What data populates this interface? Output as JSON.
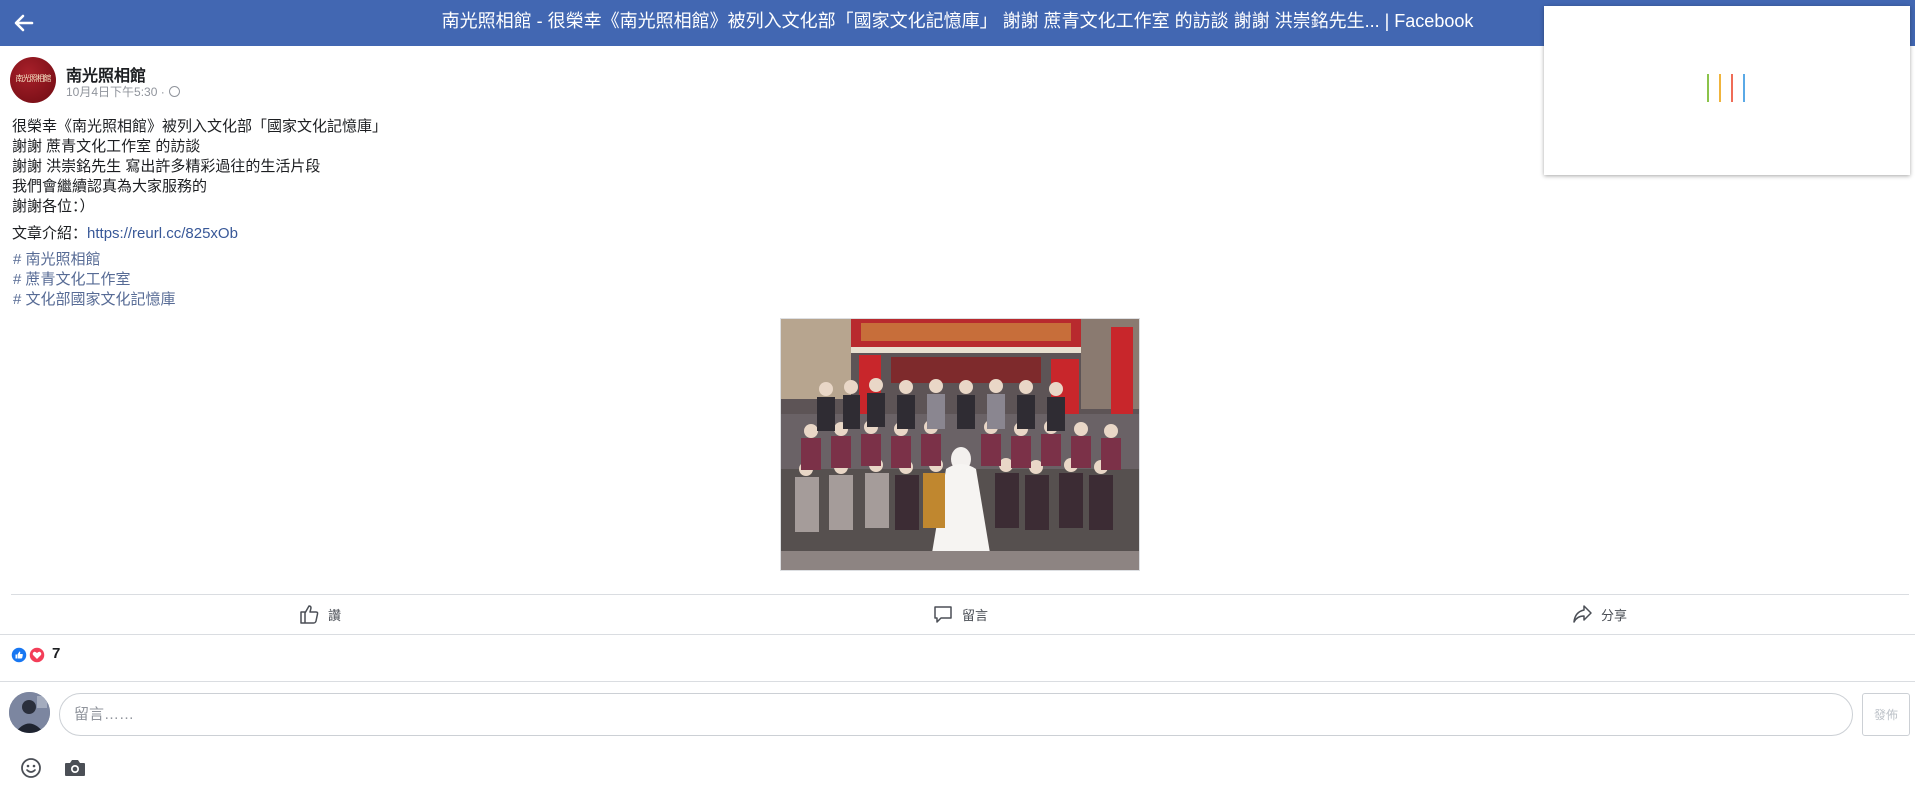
{
  "header": {
    "title": "南光照相館 - 很榮幸《南光照相館》被列入文化部「國家文化記憶庫」 謝謝 蔗青文化工作室 的訪談 謝謝 洪崇銘先生... | Facebook",
    "back_icon": "arrow-left-icon",
    "background_color": "#4267b2"
  },
  "loading_overlay": {
    "bar_colors": [
      "#8bc34a",
      "#f0b43c",
      "#ef6c57",
      "#5aa9e6"
    ]
  },
  "post": {
    "page_name": "南光照相館",
    "avatar_text": "南光照相館",
    "timestamp": "10月4日下午5:30 ·",
    "lines": [
      "很榮幸《南光照相館》被列入文化部「國家文化記憶庫」",
      "謝謝 蔗青文化工作室 的訪談",
      "謝謝 洪崇銘先生 寫出許多精彩過往的生活片段",
      "我們會繼續認真為大家服務的",
      "謝謝各位：）"
    ],
    "article_prefix": "文章介紹：",
    "article_link": "https://reurl.cc/825xOb",
    "hashtags": [
      "# 南光照相館",
      "# 蔗青文化工作室",
      "# 文化部國家文化記憶庫"
    ]
  },
  "actions": {
    "like": "讚",
    "comment": "留言",
    "share": "分享"
  },
  "reactions": {
    "count": "7",
    "icons": [
      "like-icon",
      "love-icon"
    ]
  },
  "composer": {
    "placeholder": "留言……",
    "post_button": "發佈",
    "emoji_icon": "emoji-icon",
    "camera_icon": "camera-icon"
  }
}
